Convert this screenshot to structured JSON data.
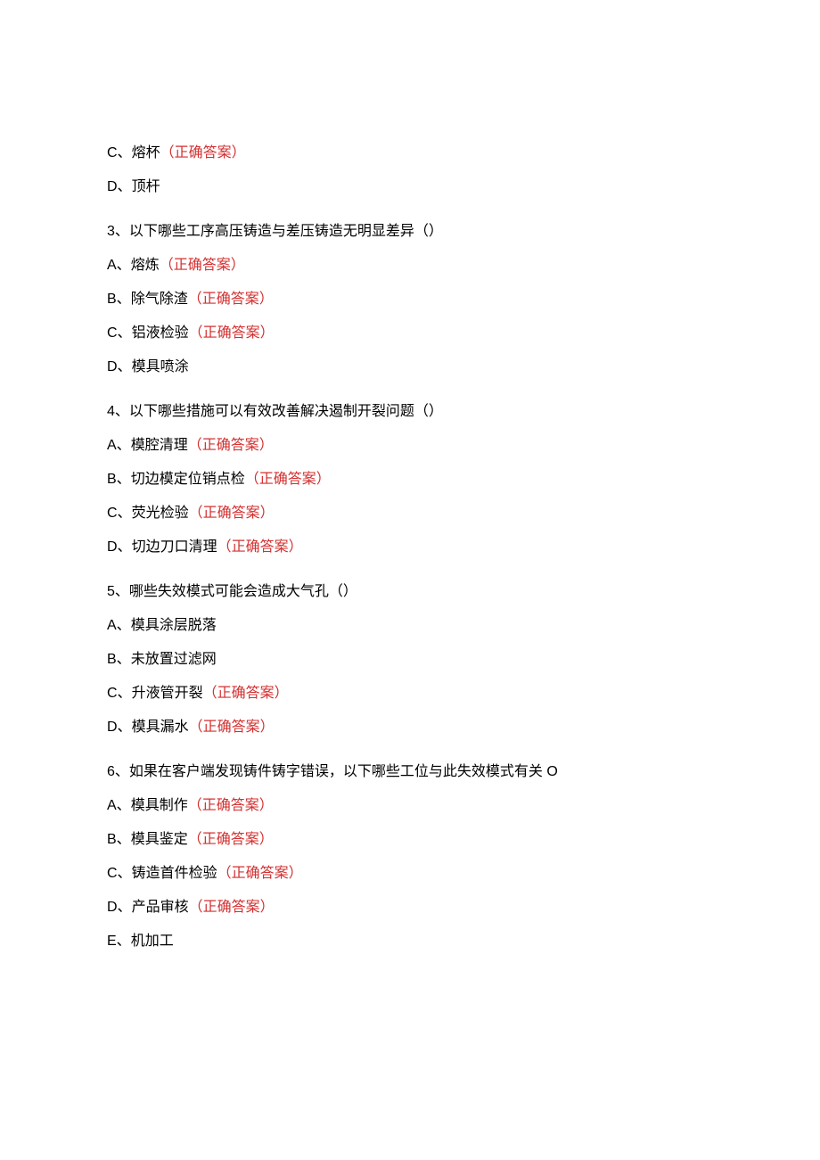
{
  "correct_label": "（正确答案）",
  "initial_options": [
    {
      "letter": "C、",
      "text": "熔杯",
      "correct": true
    },
    {
      "letter": "D、",
      "text": "顶杆",
      "correct": false
    }
  ],
  "questions": [
    {
      "number": "3、",
      "text": "以下哪些工序高压铸造与差压铸造无明显差异（）",
      "options": [
        {
          "letter": "A、",
          "text": "熔炼",
          "correct": true
        },
        {
          "letter": "B、",
          "text": "除气除渣",
          "correct": true
        },
        {
          "letter": "C、",
          "text": "铝液检验",
          "correct": true
        },
        {
          "letter": "D、",
          "text": "模具喷涂",
          "correct": false
        }
      ]
    },
    {
      "number": "4、",
      "text": "以下哪些措施可以有效改善解决遏制开裂问题（）",
      "options": [
        {
          "letter": "A、",
          "text": "模腔清理",
          "correct": true
        },
        {
          "letter": "B、",
          "text": "切边模定位销点检",
          "correct": true
        },
        {
          "letter": "C、",
          "text": "荧光检验",
          "correct": true
        },
        {
          "letter": "D、",
          "text": "切边刀口清理",
          "correct": true
        }
      ]
    },
    {
      "number": "5、",
      "text": "哪些失效模式可能会造成大气孔（）",
      "options": [
        {
          "letter": "A、",
          "text": "模具涂层脱落",
          "correct": false
        },
        {
          "letter": "B、",
          "text": "未放置过滤网",
          "correct": false
        },
        {
          "letter": "C、",
          "text": "升液管开裂",
          "correct": true
        },
        {
          "letter": "D、",
          "text": "模具漏水",
          "correct": true
        }
      ]
    },
    {
      "number": "6、",
      "text": "如果在客户端发现铸件铸字错误，以下哪些工位与此失效模式有关 O",
      "options": [
        {
          "letter": "A、",
          "text": "模具制作",
          "correct": true
        },
        {
          "letter": "B、",
          "text": "模具鉴定",
          "correct": true
        },
        {
          "letter": "C、",
          "text": "铸造首件检验",
          "correct": true
        },
        {
          "letter": "D、",
          "text": "产品审核",
          "correct": true
        },
        {
          "letter": "E、",
          "text": "机加工",
          "correct": false
        }
      ]
    }
  ]
}
